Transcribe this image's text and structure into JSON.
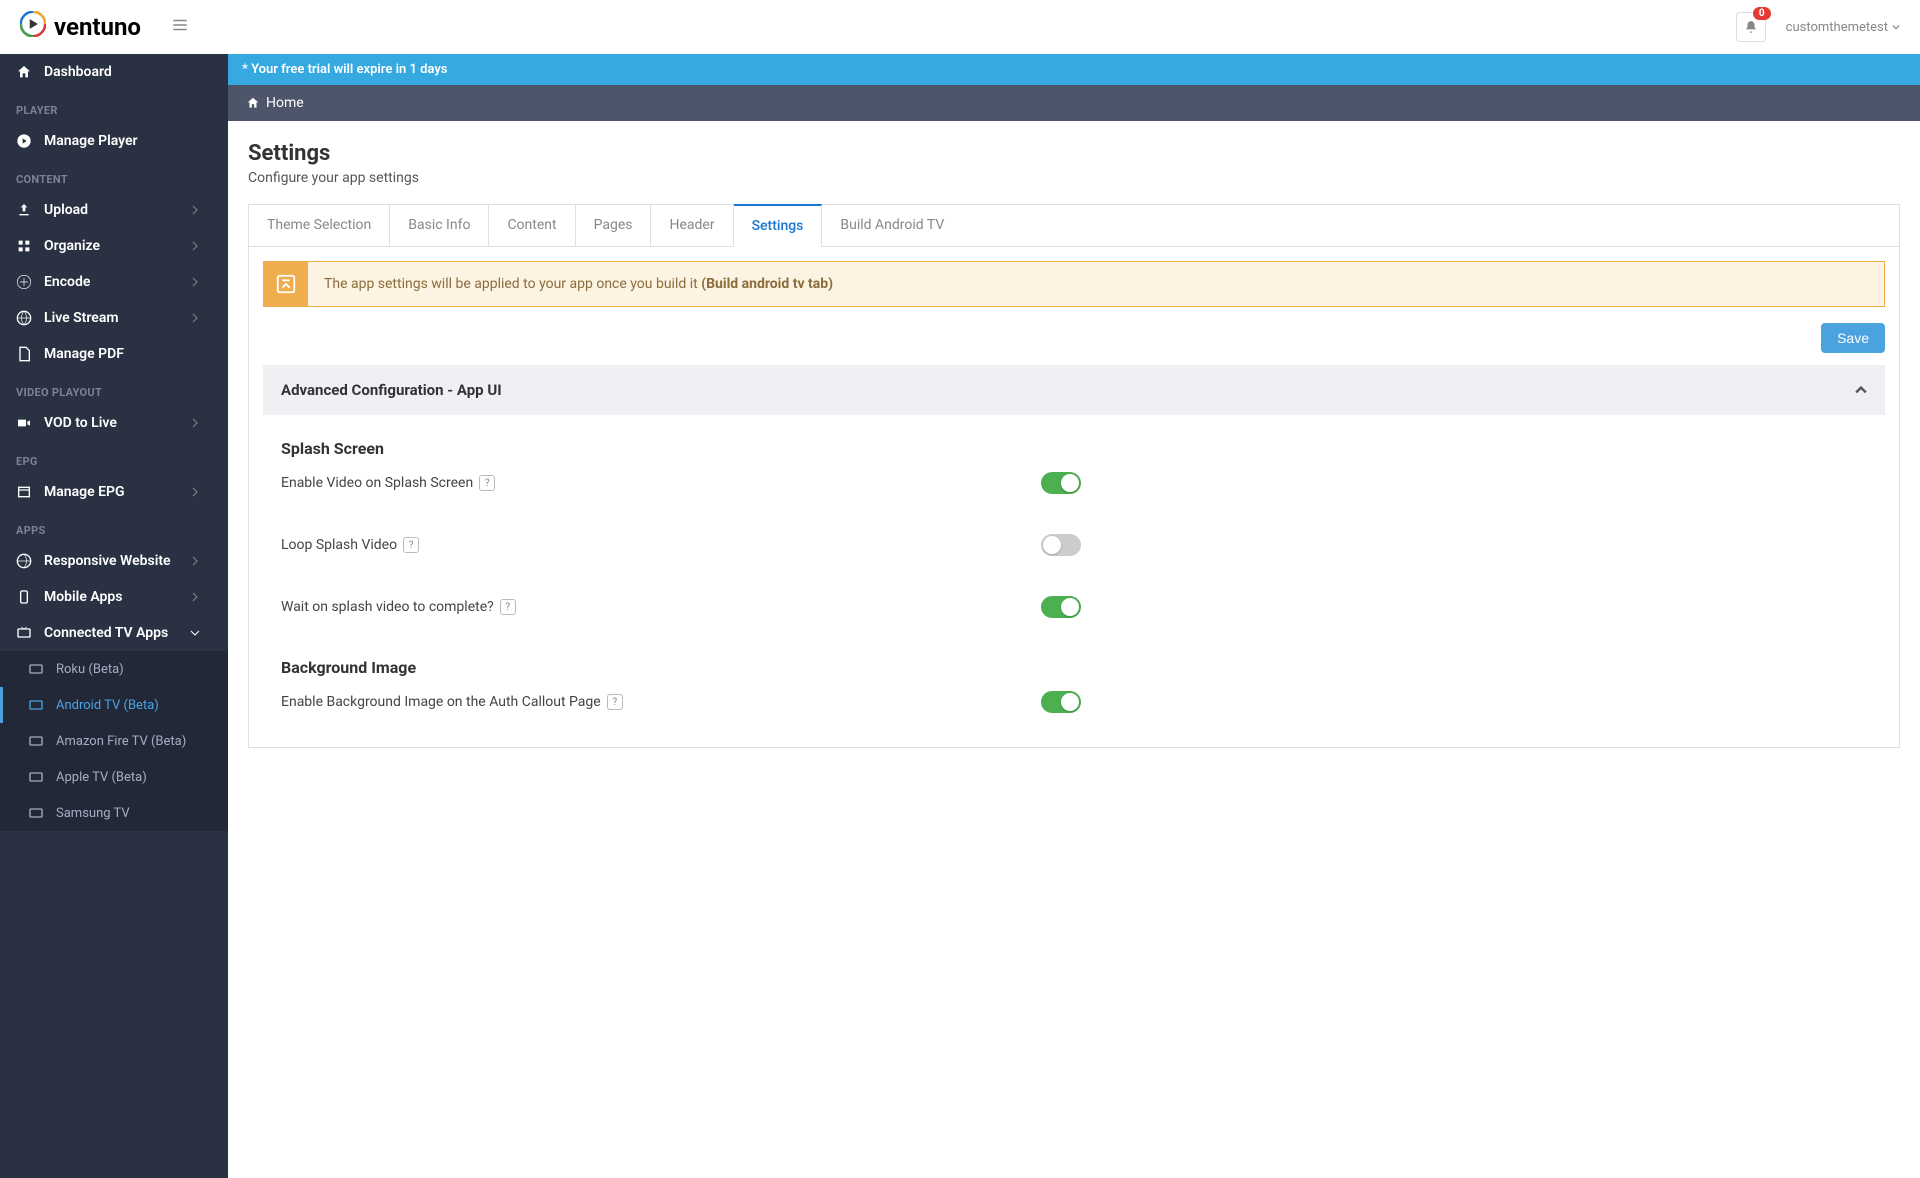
{
  "header": {
    "brand": "ventuno",
    "notification_count": "0",
    "user": "customthemetest"
  },
  "sidebar": {
    "dashboard": "Dashboard",
    "sections": {
      "player": {
        "title": "PLAYER",
        "items": [
          "Manage Player"
        ]
      },
      "content": {
        "title": "CONTENT",
        "items": [
          "Upload",
          "Organize",
          "Encode",
          "Live Stream",
          "Manage PDF"
        ]
      },
      "video_playout": {
        "title": "VIDEO PLAYOUT",
        "items": [
          "VOD to Live"
        ]
      },
      "epg": {
        "title": "EPG",
        "items": [
          "Manage EPG"
        ]
      },
      "apps": {
        "title": "APPS",
        "items": [
          "Responsive Website",
          "Mobile Apps",
          "Connected TV Apps"
        ],
        "connected_tv_sub": [
          "Roku (Beta)",
          "Android TV (Beta)",
          "Amazon Fire TV (Beta)",
          "Apple TV (Beta)",
          "Samsung TV"
        ]
      }
    }
  },
  "trial_bar": "* Your free trial will expire in 1 days",
  "breadcrumb": {
    "home": "Home"
  },
  "page": {
    "title": "Settings",
    "subtitle": "Configure your app settings"
  },
  "tabs": [
    "Theme Selection",
    "Basic Info",
    "Content",
    "Pages",
    "Header",
    "Settings",
    "Build Android TV"
  ],
  "alert": {
    "text": "The app settings will be applied to your app once you build it ",
    "bold": "(Build android tv tab)"
  },
  "buttons": {
    "save": "Save"
  },
  "accordion": {
    "title": "Advanced Configuration - App UI",
    "splash_section": "Splash Screen",
    "splash_enable": "Enable Video on Splash Screen",
    "splash_loop": "Loop Splash Video",
    "splash_wait": "Wait on splash video to complete?",
    "bg_section": "Background Image",
    "bg_enable": "Enable Background Image on the Auth Callout Page"
  }
}
